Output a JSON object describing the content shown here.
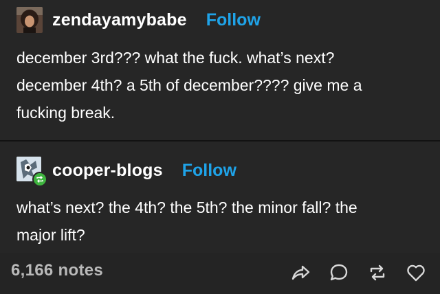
{
  "post": {
    "author": "zendayamybabe",
    "follow_label": "Follow",
    "lines": [
      "december 3rd??? what the fuck. what’s next?",
      "december 4th? a 5th of december???? give me a",
      "fucking break."
    ]
  },
  "reblog": {
    "author": "cooper-blogs",
    "follow_label": "Follow",
    "lines": [
      "what’s next? the 4th? the 5th? the minor fall? the",
      "major lift?"
    ]
  },
  "footer": {
    "notes": "6,166 notes"
  },
  "icons": {
    "share": "share-icon",
    "reply": "reply-icon",
    "reblog": "reblog-icon",
    "like": "heart-icon"
  },
  "colors": {
    "background": "#262626",
    "follow": "#1fa3e8",
    "reblog_badge": "#3fb43f",
    "notes_text": "#b9b9b9"
  }
}
